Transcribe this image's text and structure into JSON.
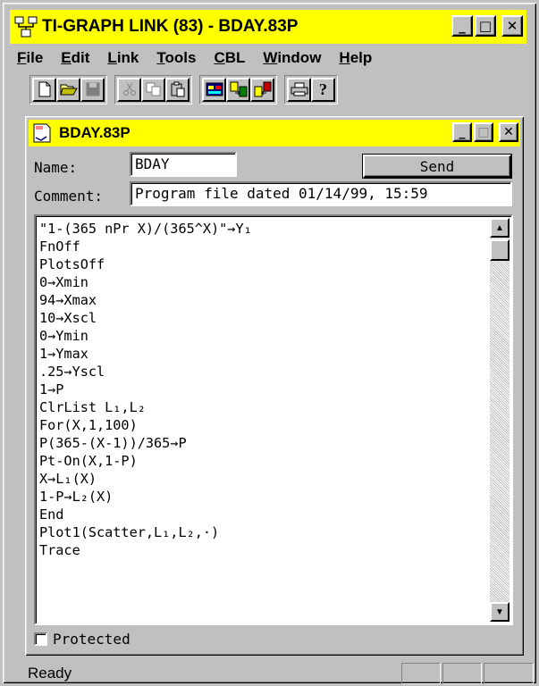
{
  "app": {
    "title": "TI-GRAPH LINK  (83) - BDAY.83P",
    "icon": "network-link-icon"
  },
  "menu": [
    {
      "label": "File",
      "mnemonic": "F",
      "rest": "ile"
    },
    {
      "label": "Edit",
      "mnemonic": "E",
      "rest": "dit"
    },
    {
      "label": "Link",
      "mnemonic": "L",
      "rest": "ink"
    },
    {
      "label": "Tools",
      "mnemonic": "T",
      "rest": "ools"
    },
    {
      "label": "CBL",
      "mnemonic": "C",
      "rest": "BL"
    },
    {
      "label": "Window",
      "mnemonic": "W",
      "rest": "indow"
    },
    {
      "label": "Help",
      "mnemonic": "H",
      "rest": "elp"
    }
  ],
  "toolbar": {
    "icons": [
      "new-file-icon",
      "open-folder-icon",
      "save-icon",
      "cut-icon",
      "copy-icon",
      "paste-icon",
      "calculator-screen-icon",
      "send-to-calculator-icon",
      "receive-from-calculator-icon",
      "print-icon",
      "help-icon"
    ]
  },
  "child": {
    "title": "BDAY.83P",
    "name_label": "Name:",
    "name_value": "BDAY",
    "send_label": "Send",
    "comment_label": "Comment:",
    "comment_value": "Program file dated 01/14/99, 15:59",
    "code_lines": [
      "\"1-(365 nPr X)/(365^X)\"→Y₁",
      "FnOff",
      "PlotsOff",
      "0→Xmin",
      "94→Xmax",
      "10→Xscl",
      "0→Ymin",
      "1→Ymax",
      ".25→Yscl",
      "1→P",
      "ClrList L₁,L₂",
      "For(X,1,100)",
      "P(365-(X-1))/365→P",
      "Pt-On(X,1-P)",
      "X→L₁(X)",
      "1-P→L₂(X)",
      "End",
      "Plot1(Scatter,L₁,L₂,·)",
      "Trace"
    ],
    "protected_label": "Protected",
    "protected_checked": false
  },
  "status": {
    "text": "Ready"
  },
  "colors": {
    "titlebar": "#ffff00",
    "face": "#c0c0c0"
  }
}
